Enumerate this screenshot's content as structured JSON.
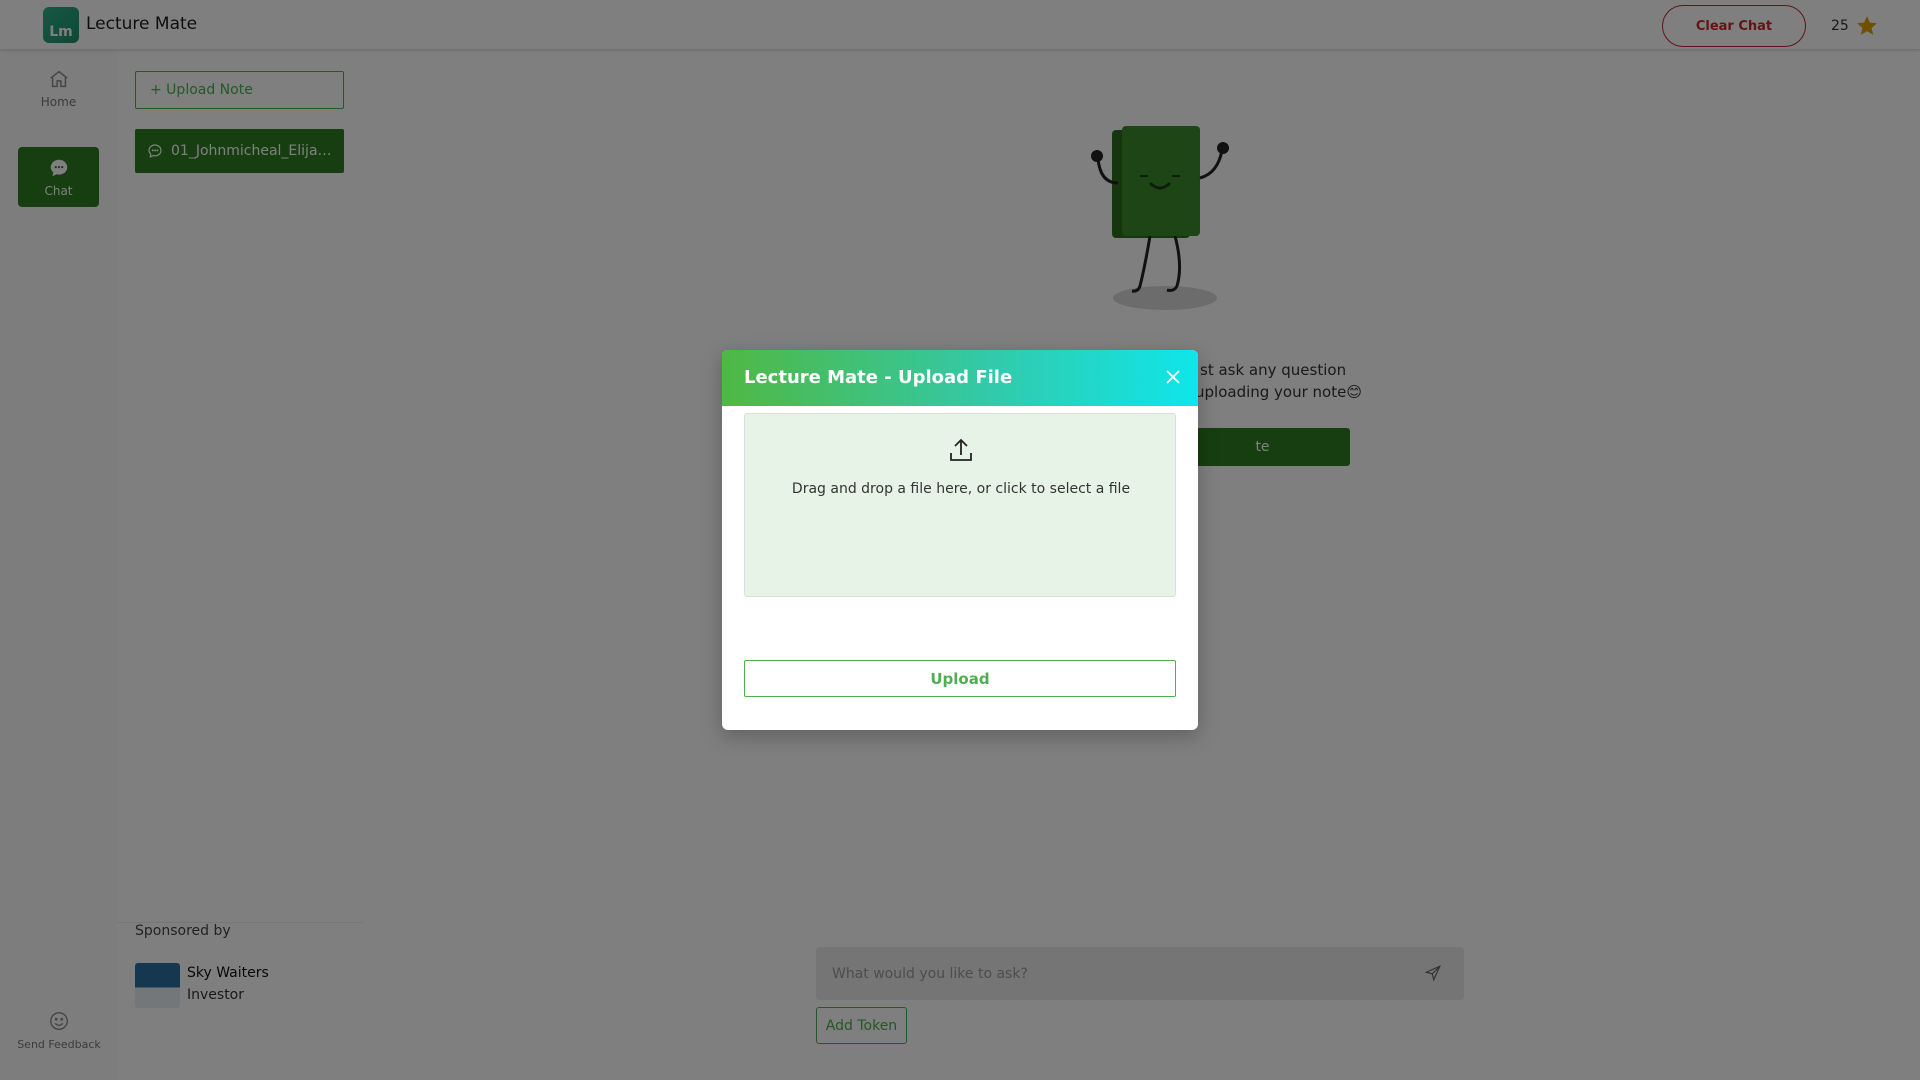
{
  "header": {
    "logo_text": "Lm",
    "app_title": "Lecture Mate",
    "clear_chat_label": "Clear Chat",
    "token_count": "25",
    "token_icon": "star-icon"
  },
  "rail": {
    "items": [
      {
        "label": "Home",
        "icon": "home-icon",
        "active": false
      },
      {
        "label": "Chat",
        "icon": "chat-icon",
        "active": true
      }
    ],
    "feedback_label": "Send Feedback"
  },
  "notes_panel": {
    "upload_note_label": "+ Upload Note",
    "notes": [
      {
        "title": "01_Johnmicheal_Elijah_..."
      }
    ],
    "sponsor": {
      "label": "Sponsored by",
      "name": "Sky Waiters",
      "role": "Investor"
    }
  },
  "main": {
    "welcome_line_1": "st ask any question",
    "welcome_line_2": "uploading your note😊",
    "upload_button_label": "te",
    "chat_input_placeholder": "What would you like to ask?",
    "add_token_label": "Add Token"
  },
  "modal": {
    "title": "Lecture Mate - Upload File",
    "dropzone_text": "Drag and drop a file here, or click to select a file",
    "upload_label": "Upload"
  },
  "colors": {
    "primary_green": "#2e7d23",
    "accent_green": "#4caf50",
    "danger": "#c62828",
    "star": "#e0a100",
    "overlay": "rgba(0,0,0,0.5)"
  }
}
